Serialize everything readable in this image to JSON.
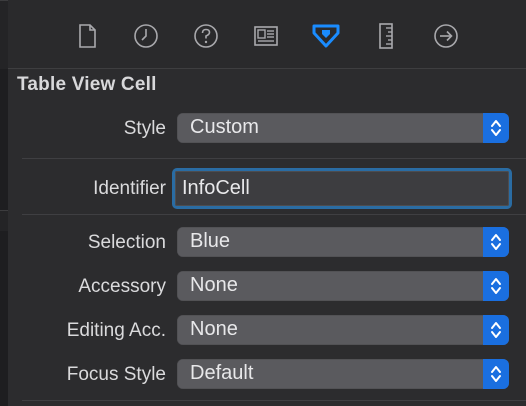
{
  "toolbar": {
    "tabs": [
      {
        "icon": "file-icon"
      },
      {
        "icon": "history-icon"
      },
      {
        "icon": "help-icon"
      },
      {
        "icon": "identity-icon"
      },
      {
        "icon": "attributes-icon",
        "selected": true
      },
      {
        "icon": "size-ruler-icon"
      },
      {
        "icon": "connections-icon"
      }
    ]
  },
  "section": {
    "title": "Table View Cell"
  },
  "fields": {
    "style": {
      "label": "Style",
      "value": "Custom"
    },
    "identifier": {
      "label": "Identifier",
      "value": "InfoCell"
    },
    "selection": {
      "label": "Selection",
      "value": "Blue"
    },
    "accessory": {
      "label": "Accessory",
      "value": "None"
    },
    "editing_accessory": {
      "label": "Editing Acc.",
      "value": "None"
    },
    "focus_style": {
      "label": "Focus Style",
      "value": "Default"
    }
  },
  "colors": {
    "accent": "#1a6fe0",
    "selected_tab": "#1a8cff",
    "icon": "#a9a9ad"
  }
}
